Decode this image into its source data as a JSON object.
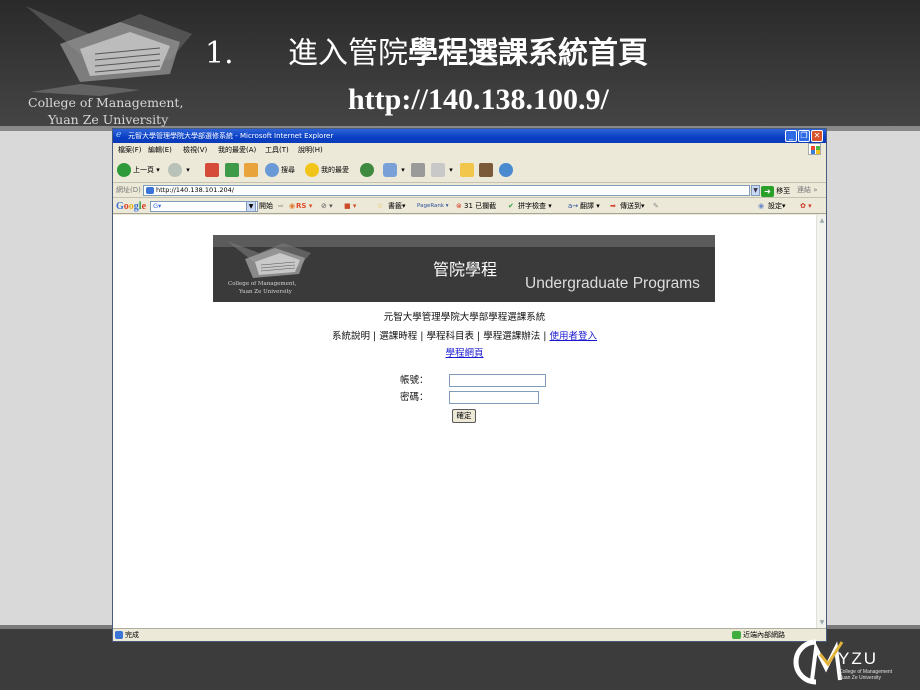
{
  "slide": {
    "title_number": "1.",
    "title_prefix": "進入管院",
    "title_bold": "學程選課系統首頁",
    "url": "http://140.138.100.9/",
    "college_line1": "College   of Management,",
    "college_line2": "Yuan Ze University"
  },
  "browser": {
    "window_title": "元智大學管理學院大學部選修系統 - Microsoft Internet Explorer",
    "menu": [
      "檔案(F)",
      "編輯(E)",
      "檢視(V)",
      "我的最愛(A)",
      "工具(T)",
      "說明(H)"
    ],
    "toolbar": {
      "back": "上一頁",
      "search": "搜尋",
      "favorites": "我的最愛"
    },
    "address_label": "網址(D)",
    "address_value": "http://140.138.101.204/",
    "go_label": "移至",
    "links_label": "連結",
    "google_bar": {
      "logo": "Google",
      "search_value": "G▾",
      "start": "開始",
      "rs": "RS",
      "bookmarks": "書籤▾",
      "pagerank": "PageRank",
      "blocked": "31 已攔截",
      "spellcheck": "拼字檢查",
      "translate": "翻譯",
      "send_to": "傳送到▾",
      "settings": "設定▾"
    },
    "status_text": "完成",
    "zone_text": "近端內部網路"
  },
  "page": {
    "banner_college_line1": "College    of Management,",
    "banner_college_line2": "Yuan Ze University",
    "banner_title": "管院學程",
    "banner_subtitle": "Undergraduate Programs",
    "system_name": "元智大學管理學院大學部學程選課系統",
    "nav_plain": "系統說明 | 選課時程 | 學程科目表 | 學程選課辦法 | ",
    "nav_login_link": "使用者登入",
    "program_link": "學程網頁",
    "account_label": "帳號：",
    "password_label": "密碼：",
    "submit_label": "確定"
  },
  "footer": {
    "logo_text": "YZU",
    "logo_sub1": "College of Management",
    "logo_sub2": "Yuan Ze University"
  },
  "colors": {
    "header_bg": "#3a3a3a",
    "slide_bg": "#d9d9d9",
    "titlebar_blue": "#0a3fc4",
    "link_blue": "#1a1ad0"
  }
}
